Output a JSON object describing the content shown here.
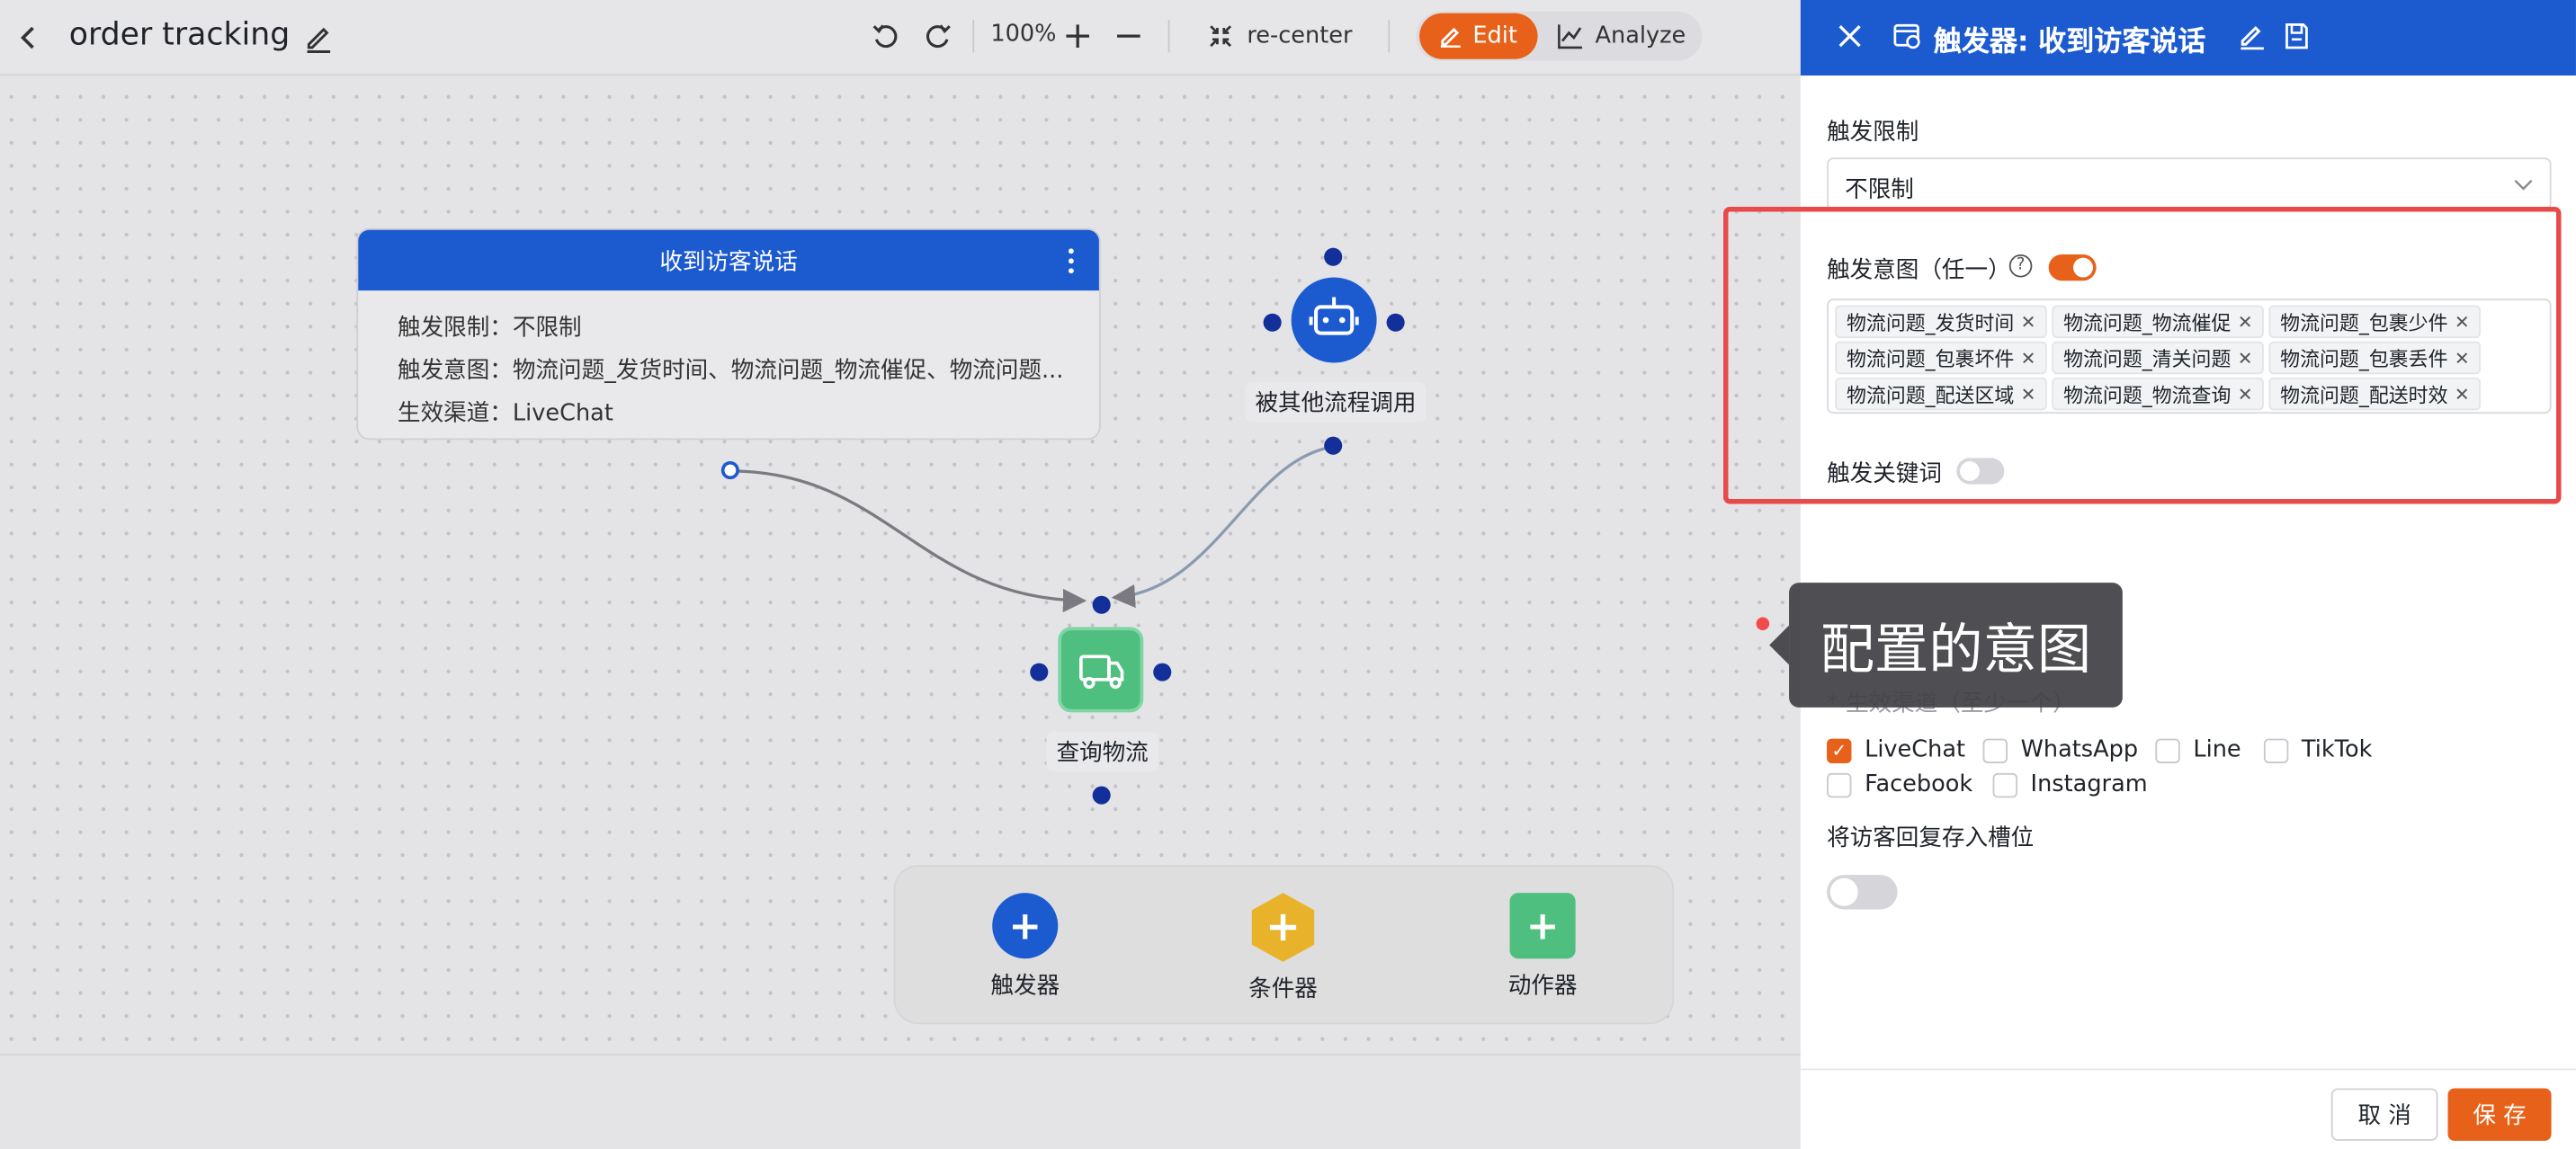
{
  "header": {
    "title": "order tracking",
    "zoom": "100%",
    "recenter_label": "re-center",
    "edit_label": "Edit",
    "analyze_label": "Analyze"
  },
  "canvas": {
    "trigger_node": {
      "title": "收到访客说话",
      "limit": "触发限制：不限制",
      "intent": "触发意图：物流问题_发货时间、物流问题_物流催促、物流问题...",
      "channel": "生效渠道：LiveChat"
    },
    "robot_node_label": "被其他流程调用",
    "action_node_label": "查询物流",
    "toolbox": {
      "trigger_label": "触发器",
      "condition_label": "条件器",
      "action_label": "动作器"
    }
  },
  "panel": {
    "title": "触发器: 收到访客说话",
    "limit_label": "触发限制",
    "limit_value": "不限制",
    "intent_label": "触发意图（任一）",
    "intent_help": "?",
    "intent_enabled": true,
    "intents": [
      "物流问题_发货时间",
      "物流问题_物流催促",
      "物流问题_包裹少件",
      "物流问题_包裹坏件",
      "物流问题_清关问题",
      "物流问题_包裹丢件",
      "物流问题_配送区域",
      "物流问题_物流查询",
      "物流问题_配送时效"
    ],
    "keyword_label": "触发关键词",
    "keyword_enabled": false,
    "tooltip": "配置的意图",
    "channels_label": "* 生效渠道（至少一个）",
    "channels": [
      {
        "name": "LiveChat",
        "checked": true
      },
      {
        "name": "WhatsApp",
        "checked": false
      },
      {
        "name": "Line",
        "checked": false
      },
      {
        "name": "TikTok",
        "checked": false
      },
      {
        "name": "Facebook",
        "checked": false
      },
      {
        "name": "Instagram",
        "checked": false
      }
    ],
    "slot_label": "将访客回复存入槽位",
    "slot_enabled": false,
    "cancel_label": "取 消",
    "save_label": "保 存"
  },
  "colors": {
    "accent": "#e8611a",
    "primary": "#1c5ad0",
    "action_green": "#4fbf7f",
    "condition_yellow": "#e8b32a",
    "highlight_red": "#e84a4a"
  }
}
